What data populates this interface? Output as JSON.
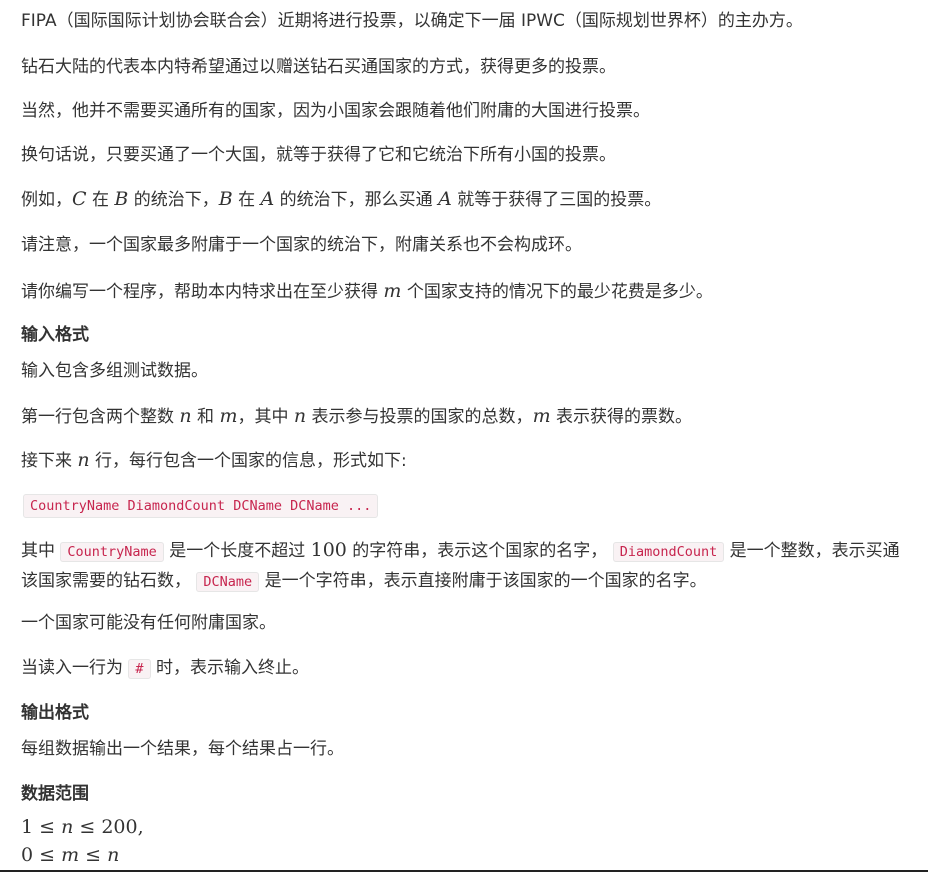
{
  "p1": "FIPA（国际国际计划协会联合会）近期将进行投票，以确定下一届 IPWC（国际规划世界杯）的主办方。",
  "p2": "钻石大陆的代表本内特希望通过以赠送钻石买通国家的方式，获得更多的投票。",
  "p3": "当然，他并不需要买通所有的国家，因为小国家会跟随着他们附庸的大国进行投票。",
  "p4": "换句话说，只要买通了一个大国，就等于获得了它和它统治下所有小国的投票。",
  "p5": {
    "t1": "例如，",
    "v1": "C",
    "t2": " 在 ",
    "v2": "B",
    "t3": " 的统治下，",
    "v3": "B",
    "t4": " 在 ",
    "v4": "A",
    "t5": " 的统治下，那么买通 ",
    "v5": "A",
    "t6": " 就等于获得了三国的投票。"
  },
  "p6": "请注意，一个国家最多附庸于一个国家的统治下，附庸关系也不会构成环。",
  "p7": {
    "t1": "请你编写一个程序，帮助本内特求出在至少获得 ",
    "v1": "m",
    "t2": " 个国家支持的情况下的最少花费是多少。"
  },
  "input_heading": "输入格式",
  "in1": "输入包含多组测试数据。",
  "in2": {
    "t1": "第一行包含两个整数 ",
    "v1": "n",
    "t2": " 和 ",
    "v2": "m",
    "t3": "，其中 ",
    "v3": "n",
    "t4": " 表示参与投票的国家的总数，",
    "v4": "m",
    "t5": " 表示获得的票数。"
  },
  "in3": {
    "t1": "接下来 ",
    "v1": "n",
    "t2": " 行，每行包含一个国家的信息，形式如下:"
  },
  "format_code": "CountryName DiamondCount DCName DCName ...",
  "desc": {
    "t1": "其中 ",
    "c1": "CountryName",
    "t2": " 是一个长度不超过 ",
    "n1": "100",
    "t3": " 的字符串，表示这个国家的名字， ",
    "c2": "DiamondCount",
    "t4": " 是一个整数，表示买通该国家需要的钻石数， ",
    "c3": "DCName",
    "t5": " 是一个字符串，表示直接附庸于该国家的一个国家的名字。"
  },
  "in4": "一个国家可能没有任何附庸国家。",
  "in5": {
    "t1": "当读入一行为 ",
    "c1": "#",
    "t2": " 时，表示输入终止。"
  },
  "output_heading": "输出格式",
  "out1": "每组数据输出一个结果，每个结果占一行。",
  "range_heading": "数据范围",
  "range1": {
    "a": "1",
    "op1": " ≤ ",
    "v": "n",
    "op2": " ≤ ",
    "b": "200",
    "end": ","
  },
  "range2": {
    "a": "0",
    "op1": " ≤ ",
    "v": "m",
    "op2": " ≤ ",
    "b": "n"
  }
}
